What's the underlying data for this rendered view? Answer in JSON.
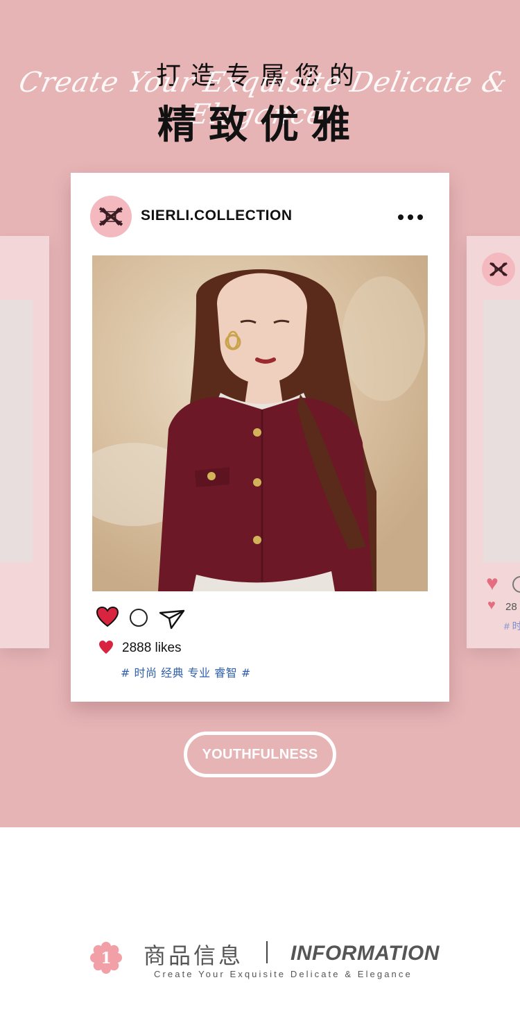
{
  "colors": {
    "hero_background": "#e7b4b6",
    "side_card": "#f3d7d8",
    "avatar_pink": "#f4b9bf",
    "heart_red": "#d8243f",
    "tag_blue": "#2f5fa8",
    "jacket": "#6d1826"
  },
  "hero": {
    "headline_small": "打造专属您的",
    "headline_big": "精致优雅",
    "script_text": "Create Your Exquisite Delicate & Elegance"
  },
  "post": {
    "username": "SIERLI.COLLECTION",
    "likes_text": "2888 likes",
    "tags": "# 时尚 经典 专业 睿智 #",
    "icons": [
      "more-icon",
      "heart-icon",
      "comment-icon",
      "share-icon",
      "small-heart-icon"
    ]
  },
  "side_post": {
    "likes_partial": "28",
    "tags_partial": "# 时"
  },
  "button": {
    "label": "YOUTHFULNESS"
  },
  "section": {
    "number": "1",
    "title_cn": "商品信息",
    "title_en": "INFORMATION",
    "subtitle": "Create Your Exquisite Delicate & Elegance"
  }
}
